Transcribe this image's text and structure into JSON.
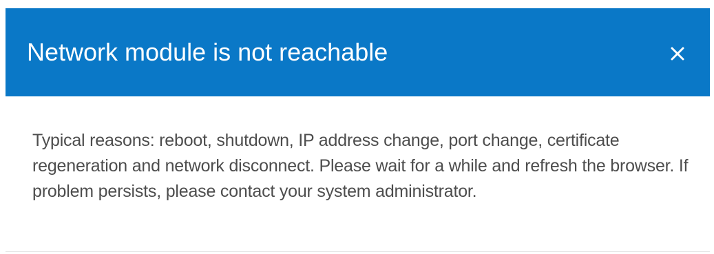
{
  "dialog": {
    "title": "Network module is not reachable",
    "close_icon": "close-icon",
    "message": "Typical reasons: reboot, shutdown, IP address change, port change, certificate regeneration and network disconnect. Please wait for a while and refresh the browser. If problem persists, please contact your system administrator."
  },
  "colors": {
    "header_background": "#0a78c7",
    "title_text": "#ffffff",
    "message_text": "#4d4d4d"
  }
}
